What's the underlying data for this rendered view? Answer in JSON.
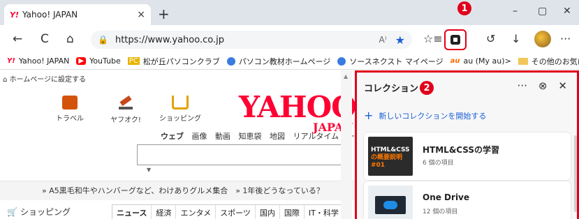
{
  "browser": {
    "tab": {
      "favicon": "Y!",
      "title": "Yahoo! JAPAN",
      "close": "×"
    },
    "new_tab": "+",
    "window": {
      "minimize": "–",
      "maximize": "▢",
      "close": "✕"
    },
    "nav": {
      "back": "←",
      "refresh": "C",
      "home": "⌂"
    },
    "address": {
      "url": "https://www.yahoo.co.jp",
      "lock": "🔒",
      "read_aloud": "A⁾",
      "star": "★"
    },
    "tools": {
      "favorites": "☆≡",
      "history": "↺",
      "download": "↓",
      "more": "···"
    }
  },
  "bookmarks": [
    {
      "icon": "Y!",
      "label": "Yahoo! JAPAN"
    },
    {
      "icon": "▶",
      "label": "YouTube"
    },
    {
      "icon": "PC",
      "label": "松が丘パソコンクラブ"
    },
    {
      "icon": "ball",
      "label": "パソコン教材ホームページ"
    },
    {
      "icon": "ball",
      "label": "ソースネクスト マイページ"
    },
    {
      "icon": "au",
      "label": "au (My au)"
    }
  ],
  "bookmarks_more": ">",
  "bookmarks_other": "その他のお気に入り",
  "page": {
    "set_home": "ホームページに設定する",
    "categories": [
      "トラベル",
      "ヤフオク!",
      "ショッピング"
    ],
    "logo": "YAHOO",
    "logo_sub": "JAPAN",
    "search_tabs": [
      "ウェブ",
      "画像",
      "動画",
      "知恵袋",
      "地図",
      "リアルタイム",
      "一覧"
    ],
    "notice": "» A5黒毛和牛やハンバーグなど、わけありグルメ集合　» 1年後どうなっている？",
    "shopping": "ショッピング",
    "news_tabs": [
      "ニュース",
      "経済",
      "エンタメ",
      "スポーツ",
      "国内",
      "国際",
      "IT・科学"
    ]
  },
  "panel": {
    "title": "コレクション",
    "more": "···",
    "unpin": "⊗",
    "close": "✕",
    "new_collection": "新しいコレクションを開始する",
    "collections": [
      {
        "name": "HTML&CSSの学習",
        "count": "6 個の項目",
        "thumb_text": [
          "HTML&CSS",
          "の概要説明",
          "#01"
        ]
      },
      {
        "name": "One Drive",
        "count": "12 個の項目"
      }
    ]
  },
  "annotations": {
    "badge1": "1",
    "badge2": "2"
  },
  "colors": {
    "highlight": "#e0001b",
    "link": "#1a5fd6",
    "yahoo_red": "#ff0033"
  }
}
